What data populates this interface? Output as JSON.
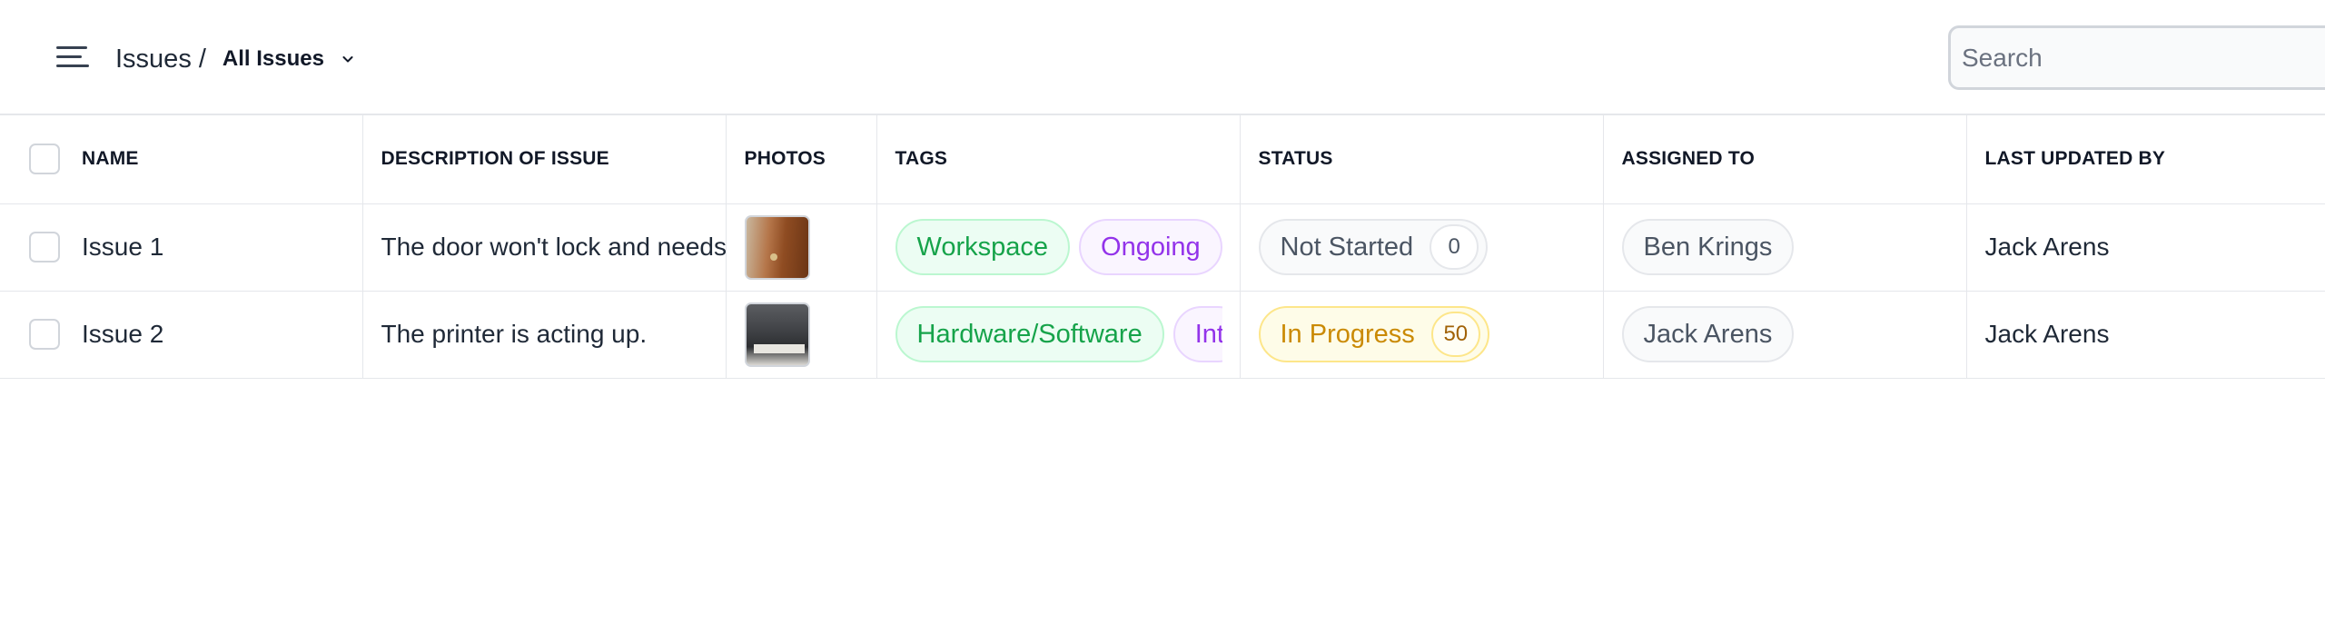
{
  "header": {
    "menu_icon": "hamburger-menu-icon",
    "breadcrumb_root": "Issues",
    "breadcrumb_separator": "/",
    "view_label": "All Issues",
    "view_chevron_icon": "chevron-down-icon"
  },
  "search": {
    "placeholder": "Search",
    "value": ""
  },
  "table": {
    "columns": [
      "NAME",
      "DESCRIPTION OF ISSUE",
      "PHOTOS",
      "TAGS",
      "STATUS",
      "ASSIGNED TO",
      "LAST UPDATED BY"
    ],
    "rows": [
      {
        "name": "Issue 1",
        "description": "The door won't lock and needs fixed.",
        "photo": "door-photo",
        "tags": [
          "Workspace",
          "Ongoing"
        ],
        "status": "Not Started",
        "status_count": "0",
        "assigned_to": "Ben Krings",
        "last_updated_by": "Jack Arens"
      },
      {
        "name": "Issue 2",
        "description": "The printer is acting up.",
        "photo": "printer-photo",
        "tags": [
          "Hardware/Software",
          "Int"
        ],
        "status": "In Progress",
        "status_count": "50",
        "assigned_to": "Jack Arens",
        "last_updated_by": "Jack Arens"
      }
    ]
  },
  "colors": {
    "tag_green": "#16a34a",
    "tag_purple": "#9333ea",
    "status_not_started": "#4b5563",
    "status_in_progress": "#ca8a04",
    "border": "#e5e7eb"
  }
}
